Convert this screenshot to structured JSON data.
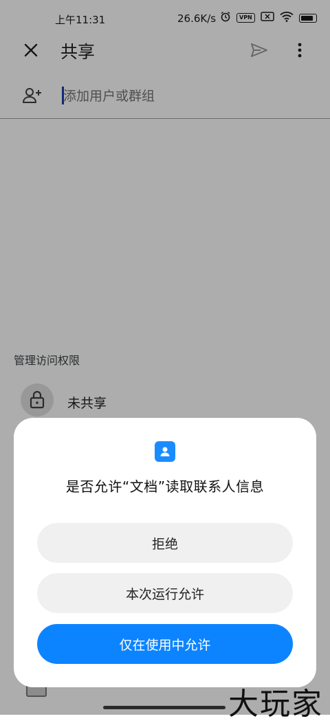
{
  "status_bar": {
    "time": "上午11:31",
    "network_speed": "26.6K/s",
    "vpn_label": "VPN",
    "icons": [
      "alarm-icon",
      "vpn-icon",
      "sim-off-icon",
      "wifi-icon",
      "battery-icon"
    ]
  },
  "app_bar": {
    "title": "共享",
    "close_icon": "close-icon",
    "send_icon": "send-icon",
    "more_icon": "more-vert-icon"
  },
  "add_people": {
    "placeholder": "添加用户或群组",
    "icon": "person-add-icon"
  },
  "manage_access": {
    "section_label": "管理访问权限",
    "status_text": "未共享",
    "icon": "lock-icon"
  },
  "permission_dialog": {
    "icon": "contacts-icon",
    "title": "是否允许“文档”读取联系人信息",
    "deny_label": "拒绝",
    "allow_once_label": "本次运行允许",
    "allow_while_using_label": "仅在使用中允许"
  },
  "watermark": "大玩家",
  "colors": {
    "accent_blue": "#0d84ff",
    "button_gray": "#f0f0f0",
    "scrim": "rgba(0,0,0,0.32)"
  }
}
